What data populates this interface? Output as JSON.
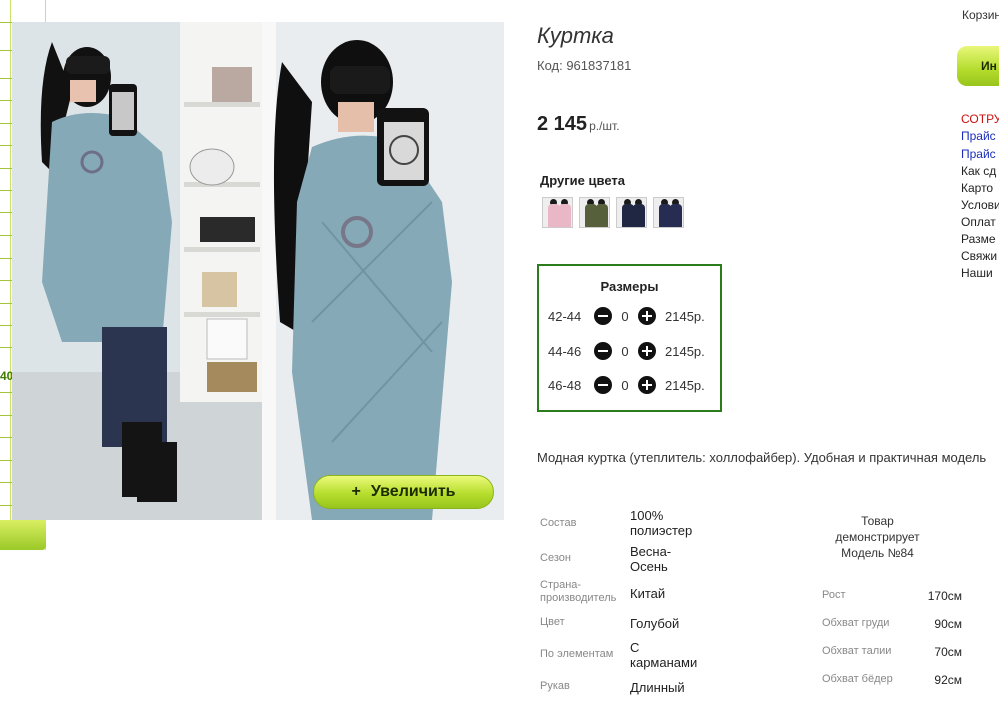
{
  "product": {
    "title": "Куртка",
    "code": "Код: 961837181",
    "price": "2 145",
    "price_unit": "р./шт.",
    "zoom_label": "Увеличить",
    "zoom_icon": "+",
    "other_colors_title": "Другие цвета",
    "swatches": [
      {
        "name": "pink",
        "color": "#e9b7c6"
      },
      {
        "name": "olive",
        "color": "#56603a"
      },
      {
        "name": "navy",
        "color": "#1f2743"
      },
      {
        "name": "dark-blue",
        "color": "#262c52"
      }
    ],
    "sizes_title": "Размеры",
    "sizes": [
      {
        "size": "42-44",
        "qty": "0",
        "price": "2145р."
      },
      {
        "size": "44-46",
        "qty": "0",
        "price": "2145р."
      },
      {
        "size": "46-48",
        "qty": "0",
        "price": "2145р."
      }
    ],
    "description": "Модная куртка (утеплитель: холлофайбер). Удобная и практичная модель",
    "specs": [
      {
        "label": "Состав",
        "value": "100% полиэстер"
      },
      {
        "label": "Сезон",
        "value": "Весна-Осень"
      },
      {
        "label": "Страна-производитель",
        "value": "Китай"
      },
      {
        "label": "Цвет",
        "value": "Голубой"
      },
      {
        "label": "По элементам",
        "value": "С карманами"
      },
      {
        "label": "Рукав",
        "value": "Длинный"
      }
    ],
    "model_title": "Товар демонстрирует Модель №84",
    "measurements": [
      {
        "label": "Рост",
        "value": "170см"
      },
      {
        "label": "Обхват груди",
        "value": "90см"
      },
      {
        "label": "Обхват талии",
        "value": "70см"
      },
      {
        "label": "Обхват бёдер",
        "value": "92см"
      }
    ]
  },
  "left_side": {
    "number": "40"
  },
  "right_col": {
    "cart": "Корзина",
    "info_button": "Ин",
    "links": [
      {
        "text": "СОТРУ",
        "style": "red"
      },
      {
        "text": "Прайс",
        "style": "blue"
      },
      {
        "text": "Прайс",
        "style": "blue"
      },
      {
        "text": "Как сд",
        "style": "plain"
      },
      {
        "text": "Карто",
        "style": "plain"
      },
      {
        "text": "Услови",
        "style": "plain"
      },
      {
        "text": "Оплат",
        "style": "plain"
      },
      {
        "text": "Разме",
        "style": "plain"
      },
      {
        "text": "Свяжи",
        "style": "plain"
      },
      {
        "text": "Наши",
        "style": "plain"
      }
    ]
  },
  "colors": {
    "accent": "#b6de2e",
    "border_green": "#2a7d1a",
    "coat_blue": "#86a9b7"
  }
}
